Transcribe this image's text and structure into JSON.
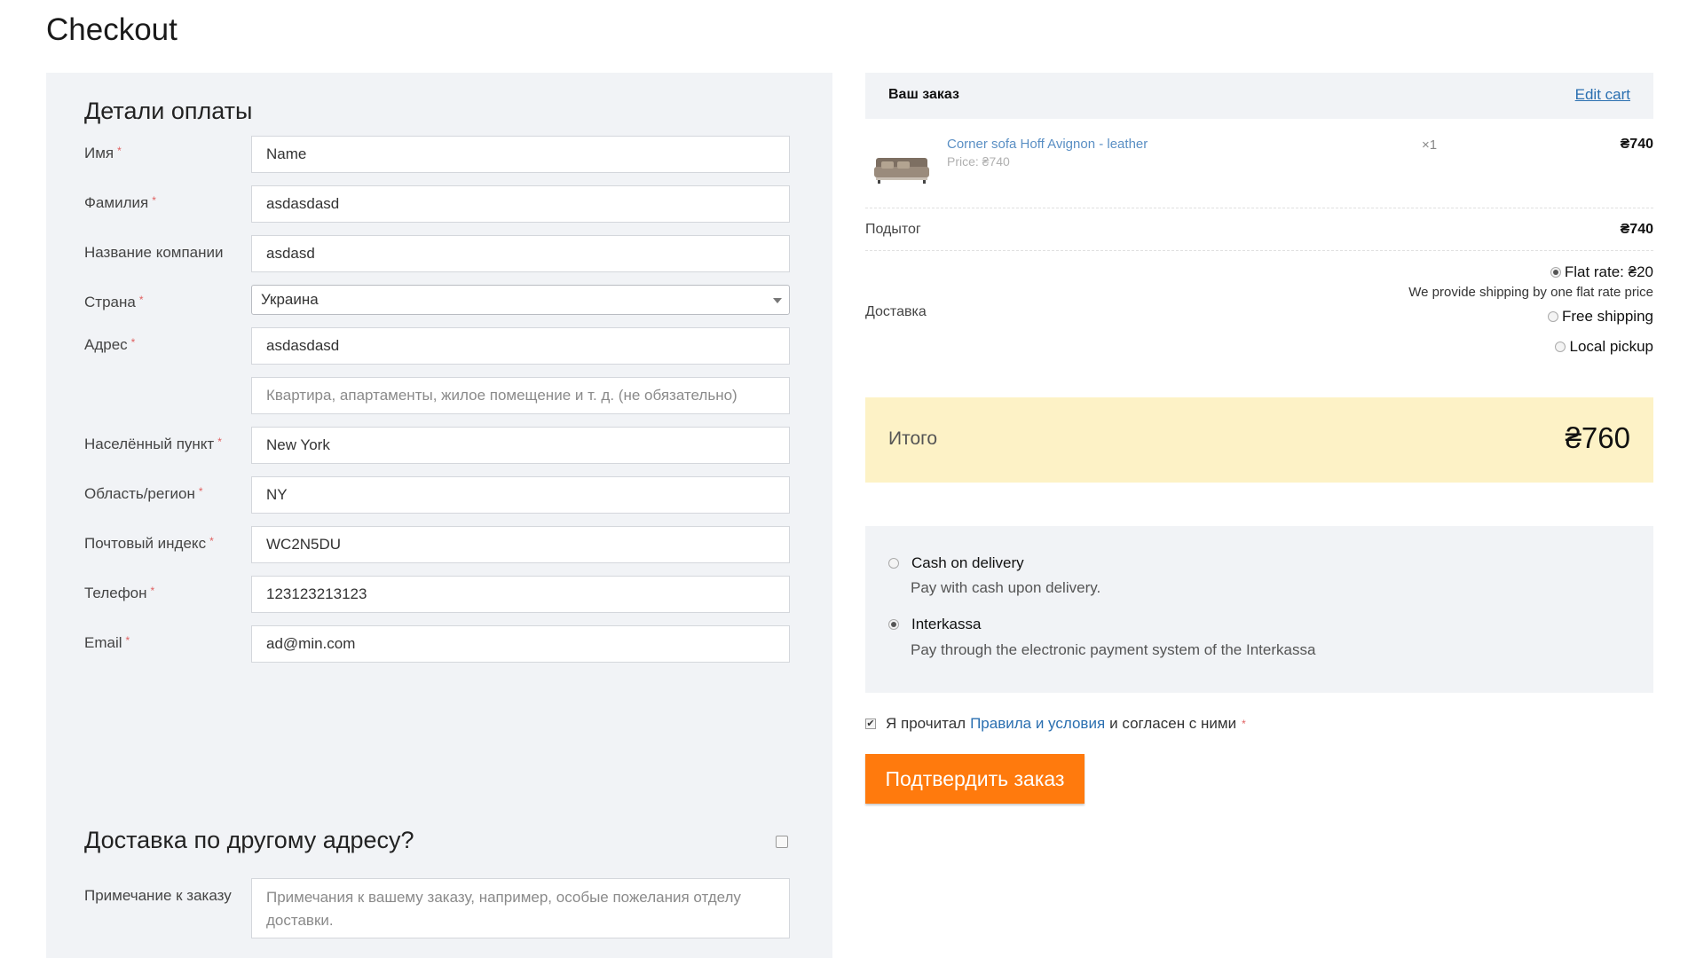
{
  "page": {
    "title": "Checkout"
  },
  "billing": {
    "heading": "Детали оплаты",
    "fields": {
      "first_name": {
        "label": "Имя",
        "value": "Name"
      },
      "last_name": {
        "label": "Фамилия",
        "value": "asdasdasd"
      },
      "company": {
        "label": "Название компании",
        "value": "asdasd"
      },
      "country": {
        "label": "Страна",
        "value": "Украина"
      },
      "address": {
        "label": "Адрес",
        "value": "asdasdasd"
      },
      "address2": {
        "placeholder": "Квартира, апартаменты, жилое помещение и т. д. (не обязательно)"
      },
      "city": {
        "label": "Населённый пункт",
        "value": "New York"
      },
      "state": {
        "label": "Область/регион",
        "value": "NY"
      },
      "postcode": {
        "label": "Почтовый индекс",
        "value": "WC2N5DU"
      },
      "phone": {
        "label": "Телефон",
        "value": "123123213123"
      },
      "email": {
        "label": "Email",
        "value": "ad@min.com"
      }
    },
    "required_mark": "*",
    "ship_different": "Доставка по другому адресу?",
    "order_notes": {
      "label": "Примечание к заказу",
      "placeholder": "Примечания к вашему заказу, например, особые пожелания отделу доставки."
    }
  },
  "order": {
    "heading": "Ваш заказ",
    "edit_cart": "Edit cart",
    "item": {
      "name": "Corner sofa Hoff Avignon - leather",
      "price": "Price: ₴740",
      "qty": "×1",
      "total": "₴740"
    },
    "subtotal": {
      "label": "Подытог",
      "value": "₴740"
    },
    "shipping": {
      "label": "Доставка",
      "options": [
        {
          "label": "Flat rate: ₴20",
          "selected": true,
          "description": "We provide shipping by one flat rate price"
        },
        {
          "label": "Free shipping",
          "selected": false
        },
        {
          "label": "Local pickup",
          "selected": false
        }
      ]
    },
    "total": {
      "label": "Итого",
      "value": "₴760"
    }
  },
  "payment": {
    "methods": [
      {
        "label": "Cash on delivery",
        "description": "Pay with cash upon delivery.",
        "selected": false
      },
      {
        "label": "Interkassa",
        "description": "Pay through the electronic payment system of the Interkassa",
        "selected": true
      }
    ]
  },
  "terms": {
    "prefix": "Я прочитал",
    "link": "Правила и условия",
    "suffix": "и согласен с ними",
    "checked": true
  },
  "submit_label": "Подтвердить заказ",
  "colors": {
    "accent": "#ff7a0d",
    "link": "#2a6fb0",
    "total_bg": "#fdf2c6",
    "panel_bg": "#f1f3f6"
  }
}
